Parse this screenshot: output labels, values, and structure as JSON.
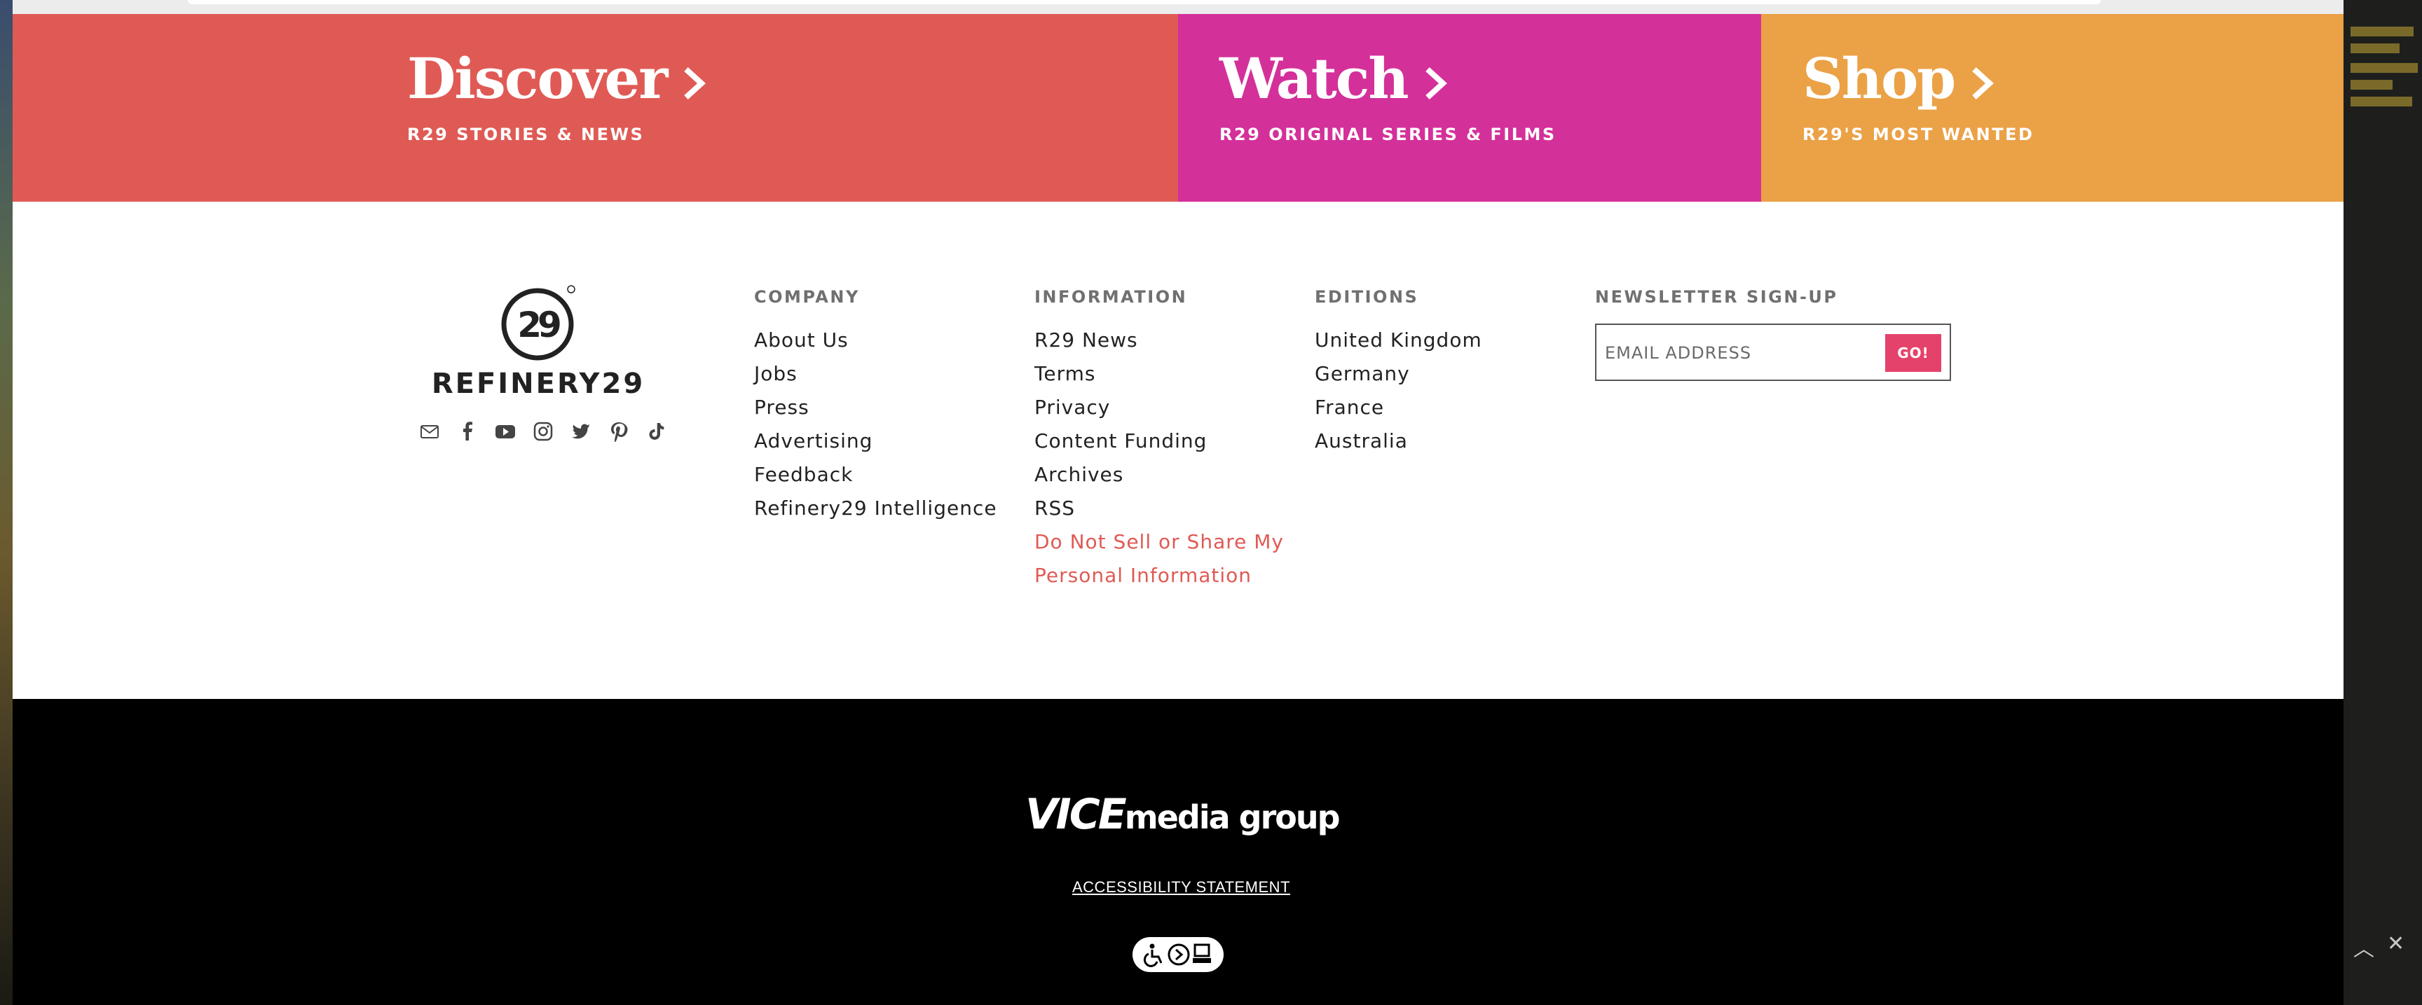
{
  "promos": {
    "discover": {
      "title": "Discover",
      "subtitle": "R29 STORIES & NEWS",
      "color": "#e05a55"
    },
    "watch": {
      "title": "Watch",
      "subtitle": "R29 ORIGINAL SERIES & FILMS",
      "color": "#d4309a"
    },
    "shop": {
      "title": "Shop",
      "subtitle": "R29'S MOST WANTED",
      "color": "#eba146"
    }
  },
  "brand": {
    "wordmark": "REFINERY29",
    "social_icons": [
      "mail-icon",
      "facebook-icon",
      "youtube-icon",
      "instagram-icon",
      "twitter-icon",
      "pinterest-icon",
      "tiktok-icon"
    ]
  },
  "company": {
    "heading": "COMPANY",
    "links": [
      "About Us",
      "Jobs",
      "Press",
      "Advertising",
      "Feedback",
      "Refinery29 Intelligence"
    ]
  },
  "information": {
    "heading": "INFORMATION",
    "links": [
      "R29 News",
      "Terms",
      "Privacy",
      "Content Funding",
      "Archives",
      "RSS"
    ],
    "dnsmpi_line1": "Do Not Sell or Share My",
    "dnsmpi_line2": "Personal Information"
  },
  "editions": {
    "heading": "EDITIONS",
    "links": [
      "United Kingdom",
      "Germany",
      "France",
      "Australia"
    ]
  },
  "newsletter": {
    "heading": "NEWSLETTER SIGN-UP",
    "placeholder": "EMAIL ADDRESS",
    "button": "GO!",
    "button_color": "#e5426b"
  },
  "bottom": {
    "vice_bold": "VICE",
    "vice_rest": "media group",
    "accessibility": "ACCESSIBILITY STATEMENT"
  },
  "desktop": {
    "up_icon": "chevron-up-icon",
    "close_icon": "close-icon"
  }
}
